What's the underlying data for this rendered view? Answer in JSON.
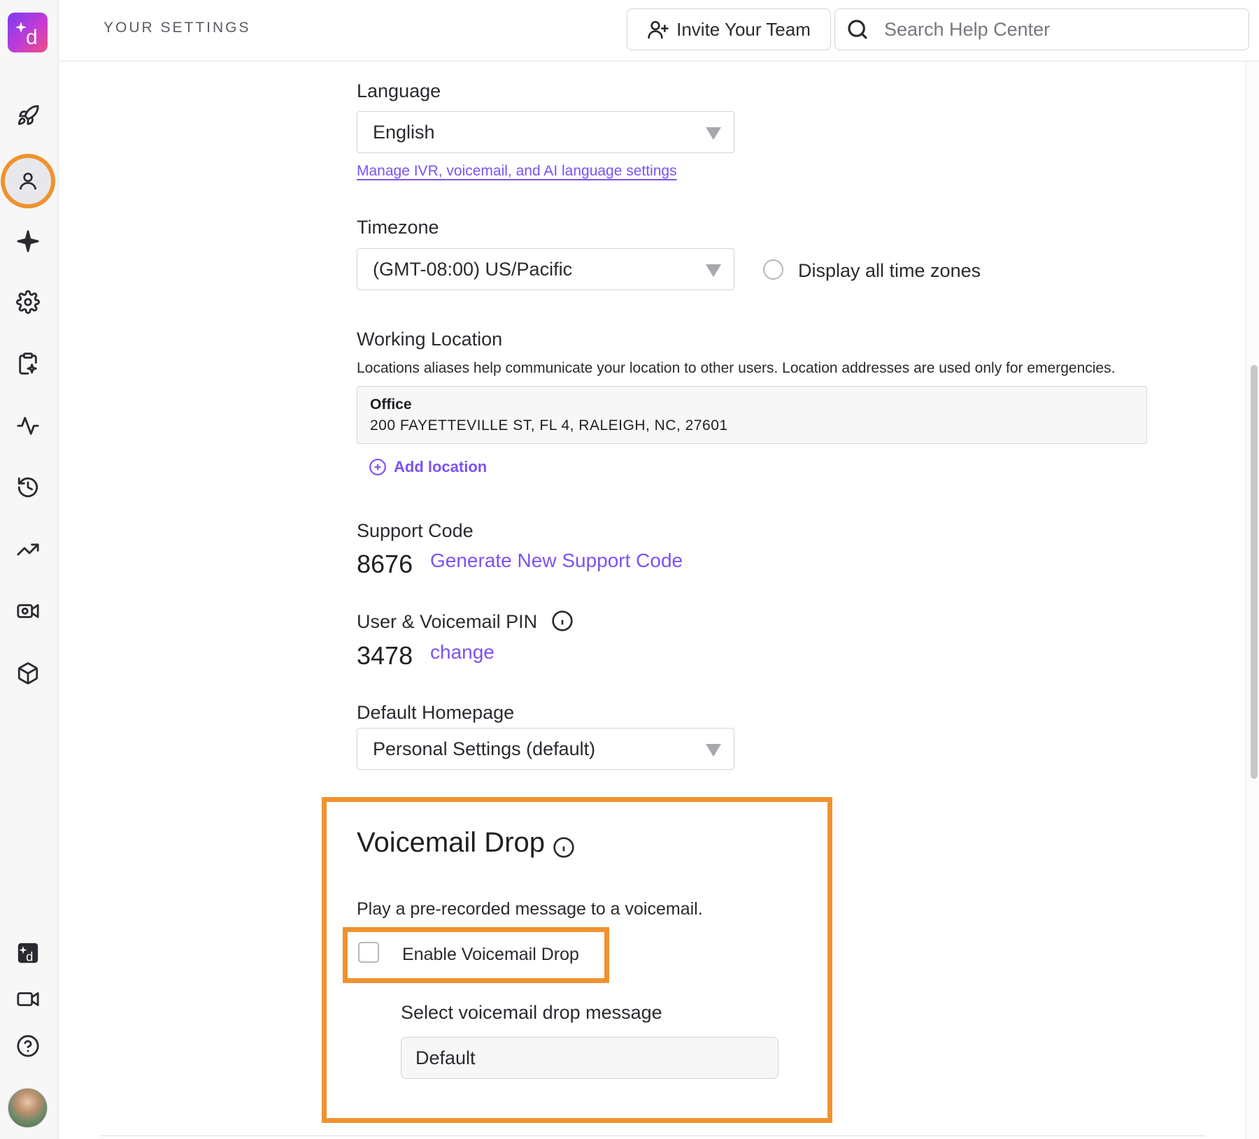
{
  "header": {
    "title": "YOUR SETTINGS",
    "invite_label": "Invite Your Team",
    "search_placeholder": "Search Help Center"
  },
  "sidebar": {
    "items": [
      {
        "icon": "rocket-icon"
      },
      {
        "icon": "user-icon",
        "active": true
      },
      {
        "icon": "sparkle-icon"
      },
      {
        "icon": "gear-icon"
      },
      {
        "icon": "clipboard-sparkle-icon"
      },
      {
        "icon": "activity-icon"
      },
      {
        "icon": "history-icon"
      },
      {
        "icon": "trending-icon"
      },
      {
        "icon": "video-settings-icon"
      },
      {
        "icon": "cube-icon"
      }
    ],
    "bottom": [
      {
        "icon": "dialpad-app-icon"
      },
      {
        "icon": "video-icon"
      },
      {
        "icon": "help-icon"
      },
      {
        "icon": "avatar"
      }
    ],
    "active_ring_color": "#f0922f"
  },
  "language": {
    "label": "Language",
    "value": "English",
    "link": "Manage IVR, voicemail, and AI language settings"
  },
  "timezone": {
    "label": "Timezone",
    "value": "(GMT-08:00) US/Pacific",
    "display_all_label": "Display all time zones"
  },
  "working_location": {
    "label": "Working Location",
    "description": "Locations aliases help communicate your location to other users. Location addresses are used only for emergencies.",
    "location_name": "Office",
    "location_address": "200 FAYETTEVILLE ST, FL 4, RALEIGH, NC, 27601",
    "add_label": "Add location"
  },
  "support_code": {
    "label": "Support Code",
    "code": "8676",
    "generate_label": "Generate New Support Code"
  },
  "pin": {
    "label": "User & Voicemail PIN",
    "value": "3478",
    "change_label": "change"
  },
  "homepage": {
    "label": "Default Homepage",
    "value": "Personal Settings (default)"
  },
  "voicemail_drop": {
    "title": "Voicemail Drop",
    "description": "Play a pre-recorded message to a voicemail.",
    "enable_label": "Enable Voicemail Drop",
    "enabled": false,
    "select_label": "Select voicemail drop message",
    "select_value": "Default"
  },
  "colors": {
    "accent": "#7c52f2",
    "highlight": "#f0922f"
  }
}
